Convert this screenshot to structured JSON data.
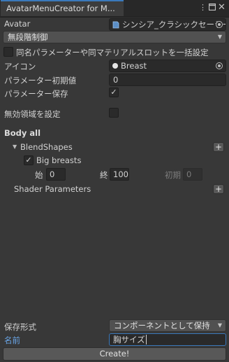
{
  "window": {
    "tab_title": "AvatarMenuCreator for M...",
    "menu_icon": "kebab-menu-icon",
    "maximize_icon": "maximize-icon",
    "close_icon": "close-icon"
  },
  "avatar": {
    "label": "Avatar",
    "value": "シンシア_クラシックセーラー (\\"
  },
  "mode_dropdown": {
    "value": "無段階制御"
  },
  "bulk_setting": {
    "label": "同名パラメーターや同マテリアルスロットを一括設定",
    "checked": false
  },
  "icon_field": {
    "label": "アイコン",
    "value": "Breast"
  },
  "param_initial": {
    "label": "パラメーター初期値",
    "value": "0"
  },
  "param_save": {
    "label": "パラメーター保存",
    "checked": true,
    "mark": "✓"
  },
  "invalid_region": {
    "label": "無効領域を設定",
    "checked": false
  },
  "section": {
    "title": "Body all",
    "blendshapes_label": "BlendShapes",
    "blendshape_item": {
      "label": "Big breasts",
      "checked": true,
      "mark": "✓"
    },
    "start_label": "始",
    "start_value": "0",
    "end_label": "終",
    "end_value": "100",
    "initial_label": "初期",
    "initial_value": "0",
    "shader_params_label": "Shader Parameters",
    "plus": "+"
  },
  "save_format": {
    "label": "保存形式",
    "value": "コンポーネントとして保持"
  },
  "name_field": {
    "label": "名前",
    "value": "胸サイズ"
  },
  "create_button": {
    "label": "Create!"
  },
  "colors": {
    "accent": "#3a79bb",
    "name_label": "#6aa6e8",
    "background": "#383838"
  }
}
